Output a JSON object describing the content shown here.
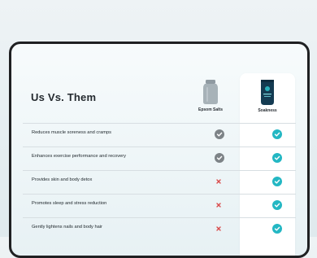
{
  "title": "Us Vs. Them",
  "columns": {
    "epsom": "Epsom Salts",
    "soakness": "Soakness"
  },
  "rows": [
    {
      "label": "Reduces muscle soreness and cramps",
      "epsom": "check",
      "soakness": "check"
    },
    {
      "label": "Enhances exercise performance and recovery",
      "epsom": "check",
      "soakness": "check"
    },
    {
      "label": "Provides skin and body detox",
      "epsom": "cross",
      "soakness": "check"
    },
    {
      "label": "Promotes sleep and stress reduction",
      "epsom": "cross",
      "soakness": "check"
    },
    {
      "label": "Gently lightens nails and body hair",
      "epsom": "cross",
      "soakness": "check"
    }
  ],
  "colors": {
    "check_epsom": "#7d8387",
    "check_soakness": "#23b7c3",
    "cross": "#d94a4a",
    "frame": "#1f2022"
  }
}
